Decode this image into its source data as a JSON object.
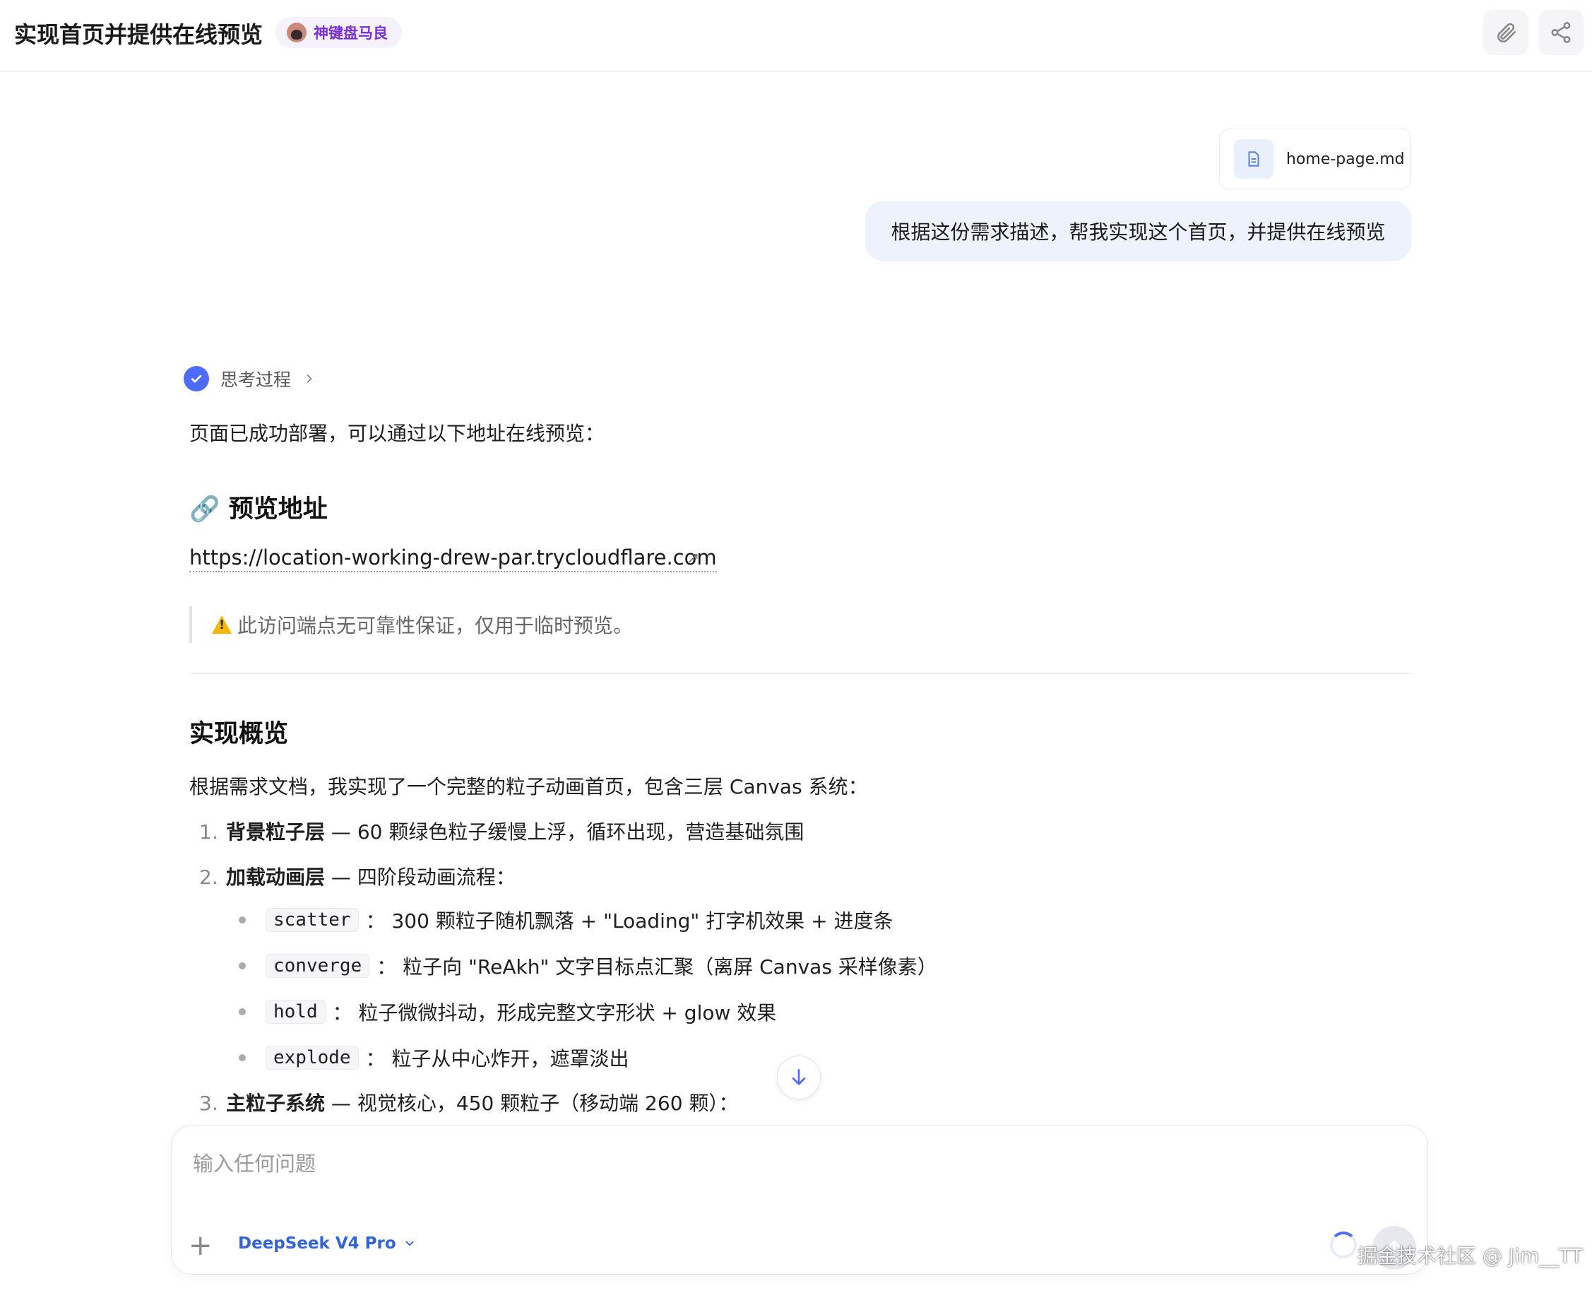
{
  "header": {
    "title": "实现首页并提供在线预览",
    "badge_label": "神键盘马良",
    "attach_icon": "paperclip-icon",
    "share_icon": "share-icon"
  },
  "user_message": {
    "attachment_name": "home-page.md",
    "text": "根据这份需求描述，帮我实现这个首页，并提供在线预览"
  },
  "assistant": {
    "thinking_label": "思考过程",
    "intro": "页面已成功部署，可以通过以下地址在线预览：",
    "preview_heading": "🔗 预览地址",
    "preview_url": "https://location-working-drew-par.trycloudflare.com",
    "warning_text": "此访问端点无可靠性保证，仅用于临时预览。",
    "overview_heading": "实现概览",
    "overview_intro": "根据需求文档，我实现了一个完整的粒子动画首页，包含三层 Canvas 系统：",
    "list": [
      {
        "num": "1.",
        "bold": "背景粒子层",
        "rest": " — 60 颗绿色粒子缓慢上浮，循环出现，营造基础氛围"
      },
      {
        "num": "2.",
        "bold": "加载动画层",
        "rest": " — 四阶段动画流程："
      },
      {
        "num": "3.",
        "bold": "主粒子系统",
        "rest": " — 视觉核心，450 颗粒子（移动端 260 颗）："
      }
    ],
    "sub_list": [
      {
        "code": "scatter",
        "text": "： 300 颗粒子随机飘落 + \"Loading\" 打字机效果 + 进度条"
      },
      {
        "code": "converge",
        "text": "： 粒子向 \"ReAkh\" 文字目标点汇聚（离屏 Canvas 采样像素）"
      },
      {
        "code": "hold",
        "text": "： 粒子微微抖动，形成完整文字形状 + glow 效果"
      },
      {
        "code": "explode",
        "text": "： 粒子从中心炸开，遮罩淡出"
      }
    ]
  },
  "composer": {
    "placeholder": "输入任何问题",
    "model_label": "DeepSeek V4 Pro"
  },
  "watermark": "掘金技术社区 @ Jim__TT"
}
